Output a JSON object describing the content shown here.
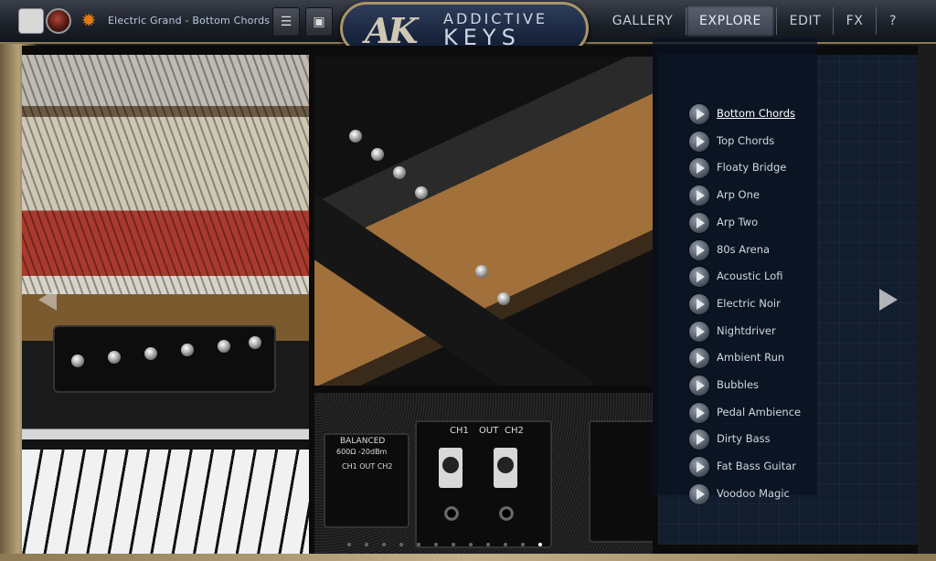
{
  "header": {
    "preset_name": "Electric Grand - Bottom Chords",
    "logo_mark": "AK",
    "logo_line1": "ADDICTIVE",
    "logo_line2": "KEYS",
    "icons": {
      "edit": "edit-icon",
      "record": "record-icon",
      "settings": "gear-icon",
      "menu": "list-menu-icon",
      "save": "save-icon"
    }
  },
  "nav": {
    "gallery": "GALLERY",
    "explore": "EXPLORE",
    "edit": "EDIT",
    "fx": "FX",
    "help": "?",
    "active": "explore"
  },
  "photo_labels": {
    "ch1": "CH1",
    "out": "OUT",
    "ch2": "CH2",
    "balanced": "BALANCED",
    "impedance": "600Ω -20dBm",
    "small_ch": "CH1 OUT CH2"
  },
  "presets": {
    "selected": "Bottom Chords",
    "items": [
      "Bottom Chords",
      "Top Chords",
      "Floaty Bridge",
      "Arp One",
      "Arp Two",
      "80s Arena",
      "Acoustic Lofi",
      "Electric Noir",
      "Nightdriver",
      "Ambient Run",
      "Bubbles",
      "Pedal Ambience",
      "Dirty Bass",
      "Fat Bass Guitar",
      "Voodoo Magic"
    ]
  },
  "pager": {
    "total_pages": 12,
    "current_page": 12
  },
  "colors": {
    "frame_gold": "#b6a27a",
    "accent_orange": "#e07a18",
    "panel_blue": "#121d2e"
  }
}
